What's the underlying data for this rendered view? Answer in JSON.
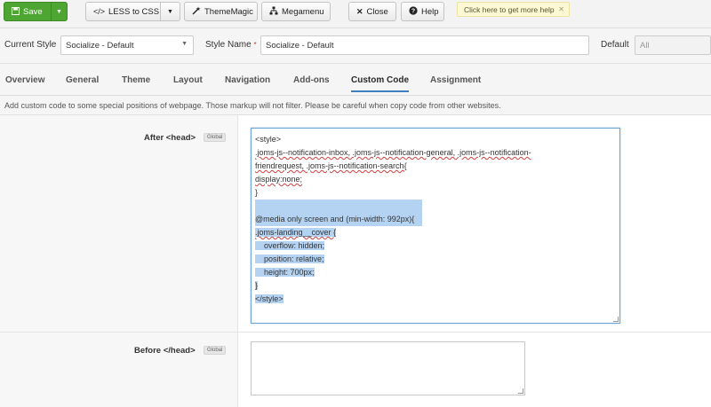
{
  "toolbar": {
    "save": "Save",
    "less_to_css": "LESS to CSS",
    "thememagic": "ThemeMagic",
    "megamenu": "Megamenu",
    "close": "Close",
    "help": "Help",
    "help_tip": "Click here to get more help",
    "icons": {
      "save": "floppy-disk-icon",
      "less": "code-icon",
      "thememagic": "magic-wand-icon",
      "megamenu": "sitemap-icon",
      "close": "close-icon",
      "help": "question-circle-icon"
    },
    "save_color": "#4ea632"
  },
  "style_row": {
    "current_style_label": "Current Style",
    "current_style_value": "Socialize - Default",
    "style_name_label": "Style Name",
    "style_name_required": "*",
    "style_name_value": "Socialize - Default",
    "default_label": "Default",
    "default_value": "All"
  },
  "tabs": [
    {
      "label": "Overview"
    },
    {
      "label": "General"
    },
    {
      "label": "Theme"
    },
    {
      "label": "Layout"
    },
    {
      "label": "Navigation"
    },
    {
      "label": "Add-ons"
    },
    {
      "label": "Custom Code",
      "active": true
    },
    {
      "label": "Assignment"
    }
  ],
  "description": "Add custom code to some special positions of webpage. Those markup will not filter. Please be careful when copy code from other websites.",
  "after_head": {
    "label": "After <head>",
    "badge": "Global",
    "code_lines": [
      "<style>",
      ".joms-js--notification-inbox, .joms-js--notification-general, .joms-js--notification-",
      "friendrequest, .joms-js--notification-search{",
      "display:none;",
      "}",
      "",
      "@media only screen and (min-width: 992px){",
      ".joms-landing__cover {",
      "    overflow: hidden;",
      "    position: relative;",
      "    height: 700px;",
      "}",
      "</style>"
    ]
  },
  "before_head": {
    "label": "Before </head>",
    "badge": "Global",
    "value": ""
  },
  "colors": {
    "accent": "#3d7fbf",
    "selection": "#b4d3f2"
  }
}
